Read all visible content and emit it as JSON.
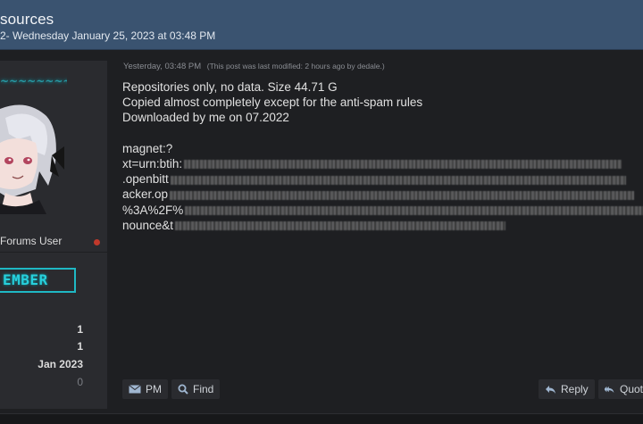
{
  "thread": {
    "title": "sources",
    "subtitle": "2- Wednesday January 25, 2023 at 03:48 PM"
  },
  "sidebar": {
    "username": "~~~~~~~~~~~",
    "user_title": "Forums User",
    "badge": "EMBER",
    "stats": [
      "1",
      "1",
      "Jan 2023",
      "0"
    ]
  },
  "post": {
    "timestamp": "Yesterday, 03:48 PM",
    "edited_note": "(This post was last modified: 2 hours ago by dedale.)",
    "lines": [
      "Repositories only, no data. Size 44.71 G",
      "Copied almost completely except for the anti-spam rules",
      "Downloaded by me on 07.2022"
    ],
    "magnet": [
      "magnet:?",
      "xt=urn:btih:",
      ".openbitt",
      "acker.op",
      "%3A%2F%",
      "nounce&t"
    ]
  },
  "actions": {
    "pm": "PM",
    "find": "Find",
    "reply": "Reply",
    "quote": "Quot"
  },
  "colors": {
    "header": "#3a5370",
    "accent_cyan": "#27d0dc",
    "status_offline": "#c0392b"
  }
}
